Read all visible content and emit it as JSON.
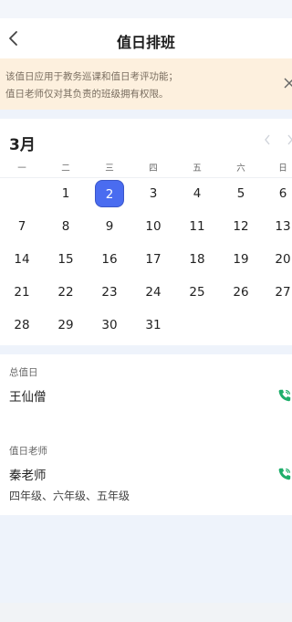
{
  "header": {
    "title": "值日排班"
  },
  "notice": {
    "line1": "该值日应用于教务巡课和值日考评功能；",
    "line2": "值日老师仅对其负责的班级拥有权限。"
  },
  "calendar": {
    "month": "3月",
    "weekdays": [
      "一",
      "二",
      "三",
      "四",
      "五",
      "六",
      "日"
    ],
    "weeks": [
      [
        "",
        "1",
        "2",
        "3",
        "4",
        "5",
        "6"
      ],
      [
        "7",
        "8",
        "9",
        "10",
        "11",
        "12",
        "13"
      ],
      [
        "14",
        "15",
        "16",
        "17",
        "18",
        "19",
        "20"
      ],
      [
        "21",
        "22",
        "23",
        "24",
        "25",
        "26",
        "27"
      ],
      [
        "28",
        "29",
        "30",
        "31",
        "",
        "",
        ""
      ]
    ],
    "selected": "2"
  },
  "duty": {
    "chief_label": "总值日",
    "chief_name": "王仙僧",
    "teacher_label": "值日老师",
    "teacher_name": "秦老师",
    "teacher_grades": "四年级、六年级、五年级"
  },
  "colors": {
    "accent": "#4a6cf0",
    "notice_bg": "#fdf0de",
    "phone": "#1fae6b"
  },
  "icons": {
    "back": "chevron-left-icon",
    "close": "close-icon",
    "prev": "chevron-left-icon",
    "next": "chevron-right-icon",
    "phone": "phone-icon"
  }
}
